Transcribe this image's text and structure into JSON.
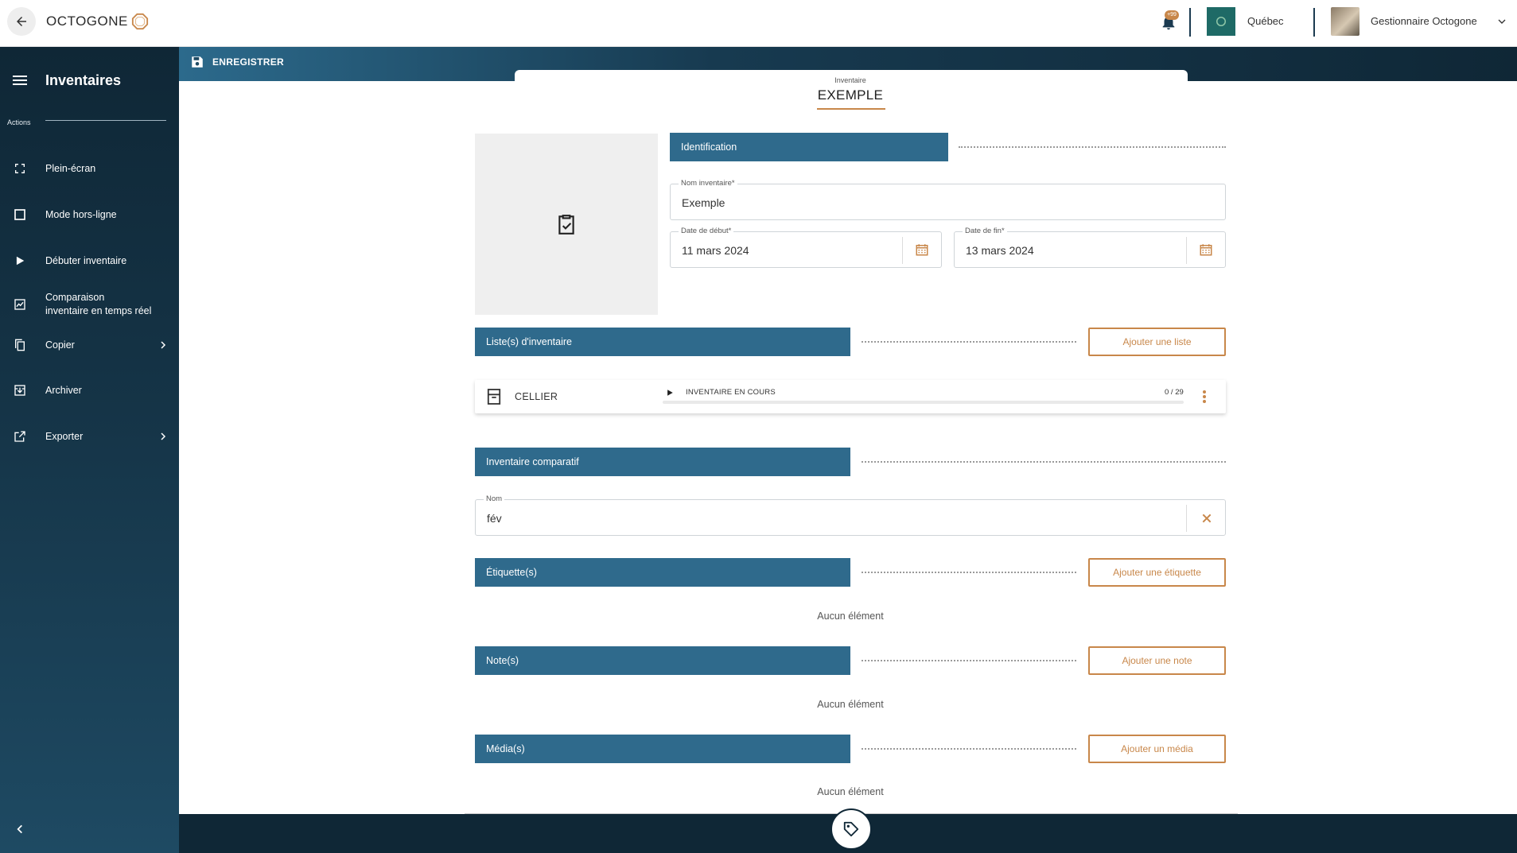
{
  "app": {
    "name": "OCTOGONE",
    "notification_count": "+99",
    "region": "Québec",
    "user": "Gestionnaire Octogone"
  },
  "sidebar": {
    "title": "Inventaires",
    "actions_label": "Actions",
    "items": [
      {
        "label": "Plein-écran",
        "icon": "fullscreen-icon"
      },
      {
        "label": "Mode hors-ligne",
        "icon": "checkbox-icon"
      },
      {
        "label": "Débuter inventaire",
        "icon": "play-icon"
      },
      {
        "label": "Comparaison\ninventaire en temps réel",
        "icon": "chart-icon"
      },
      {
        "label": "Copier",
        "icon": "copy-icon"
      },
      {
        "label": "Archiver",
        "icon": "archive-icon"
      },
      {
        "label": "Exporter",
        "icon": "export-icon"
      }
    ]
  },
  "toolbar": {
    "save_label": "ENREGISTRER"
  },
  "header": {
    "subtitle": "Inventaire",
    "title": "EXEMPLE"
  },
  "identification": {
    "section_label": "Identification",
    "name_label": "Nom inventaire*",
    "name_value": "Exemple",
    "start_label": "Date de début*",
    "start_value": "11 mars 2024",
    "end_label": "Date de fin*",
    "end_value": "13 mars 2024"
  },
  "lists": {
    "section_label": "Liste(s) d'inventaire",
    "add_label": "Ajouter une liste",
    "items": [
      {
        "name": "CELLIER",
        "status": "INVENTAIRE EN COURS",
        "count": "0 / 29",
        "progress": 0
      }
    ]
  },
  "comparative": {
    "section_label": "Inventaire comparatif",
    "name_label": "Nom",
    "name_value": "fév"
  },
  "tags": {
    "section_label": "Étiquette(s)",
    "add_label": "Ajouter une étiquette",
    "empty": "Aucun élément"
  },
  "notes": {
    "section_label": "Note(s)",
    "add_label": "Ajouter une note",
    "empty": "Aucun élément"
  },
  "media": {
    "section_label": "Média(s)",
    "add_label": "Ajouter un média",
    "empty": "Aucun élément"
  },
  "colors": {
    "primary": "#2f6a8c",
    "dark": "#0f2736",
    "accent": "#c8874a"
  }
}
